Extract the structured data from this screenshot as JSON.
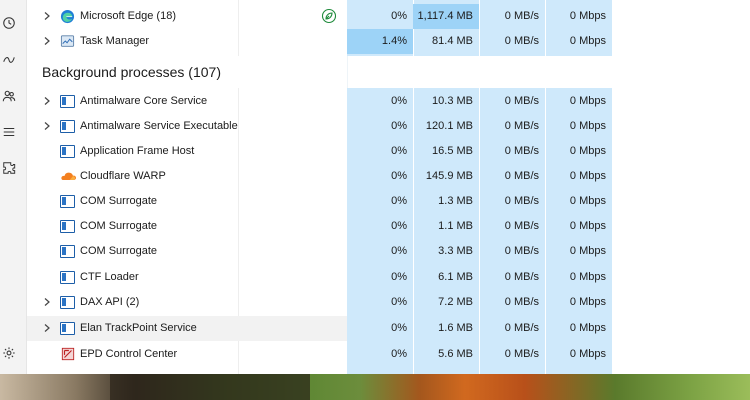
{
  "nav": [
    {
      "name": "history-icon"
    },
    {
      "name": "startup-apps-icon"
    },
    {
      "name": "users-icon"
    },
    {
      "name": "details-icon"
    },
    {
      "name": "services-icon"
    },
    {
      "name": "settings-icon"
    }
  ],
  "apps": [
    {
      "name": "Microsoft Edge (18)",
      "icon": "edge-icon",
      "expandable": true,
      "eco": true,
      "cpu": "0%",
      "memory": "1,117.4 MB",
      "disk": "0 MB/s",
      "network": "0 Mbps"
    },
    {
      "name": "Task Manager",
      "icon": "task-manager-icon",
      "expandable": true,
      "eco": false,
      "cpu": "1.4%",
      "memory": "81.4 MB",
      "disk": "0 MB/s",
      "network": "0 Mbps"
    }
  ],
  "background": {
    "title": "Background processes (107)",
    "rows": [
      {
        "name": "Antimalware Core Service",
        "icon": "service-box-icon",
        "expandable": true,
        "cpu": "0%",
        "memory": "10.3 MB",
        "disk": "0 MB/s",
        "network": "0 Mbps"
      },
      {
        "name": "Antimalware Service Executable",
        "icon": "service-box-icon",
        "expandable": true,
        "cpu": "0%",
        "memory": "120.1 MB",
        "disk": "0 MB/s",
        "network": "0 Mbps"
      },
      {
        "name": "Application Frame Host",
        "icon": "service-box-icon",
        "expandable": false,
        "cpu": "0%",
        "memory": "16.5 MB",
        "disk": "0 MB/s",
        "network": "0 Mbps"
      },
      {
        "name": "Cloudflare WARP",
        "icon": "cloudflare-icon",
        "expandable": false,
        "cpu": "0%",
        "memory": "145.9 MB",
        "disk": "0 MB/s",
        "network": "0 Mbps"
      },
      {
        "name": "COM Surrogate",
        "icon": "service-box-icon",
        "expandable": false,
        "cpu": "0%",
        "memory": "1.3 MB",
        "disk": "0 MB/s",
        "network": "0 Mbps"
      },
      {
        "name": "COM Surrogate",
        "icon": "service-box-icon",
        "expandable": false,
        "cpu": "0%",
        "memory": "1.1 MB",
        "disk": "0 MB/s",
        "network": "0 Mbps"
      },
      {
        "name": "COM Surrogate",
        "icon": "service-box-icon",
        "expandable": false,
        "cpu": "0%",
        "memory": "3.3 MB",
        "disk": "0 MB/s",
        "network": "0 Mbps"
      },
      {
        "name": "CTF Loader",
        "icon": "service-box-icon",
        "expandable": false,
        "cpu": "0%",
        "memory": "6.1 MB",
        "disk": "0 MB/s",
        "network": "0 Mbps"
      },
      {
        "name": "DAX API (2)",
        "icon": "service-box-icon",
        "expandable": true,
        "cpu": "0%",
        "memory": "7.2 MB",
        "disk": "0 MB/s",
        "network": "0 Mbps"
      },
      {
        "name": "Elan TrackPoint Service",
        "icon": "service-box-icon",
        "expandable": true,
        "cpu": "0%",
        "memory": "1.6 MB",
        "disk": "0 MB/s",
        "network": "0 Mbps"
      },
      {
        "name": "EPD Control Center",
        "icon": "epd-icon",
        "expandable": false,
        "cpu": "0%",
        "memory": "5.6 MB",
        "disk": "0 MB/s",
        "network": "0 Mbps"
      }
    ]
  }
}
